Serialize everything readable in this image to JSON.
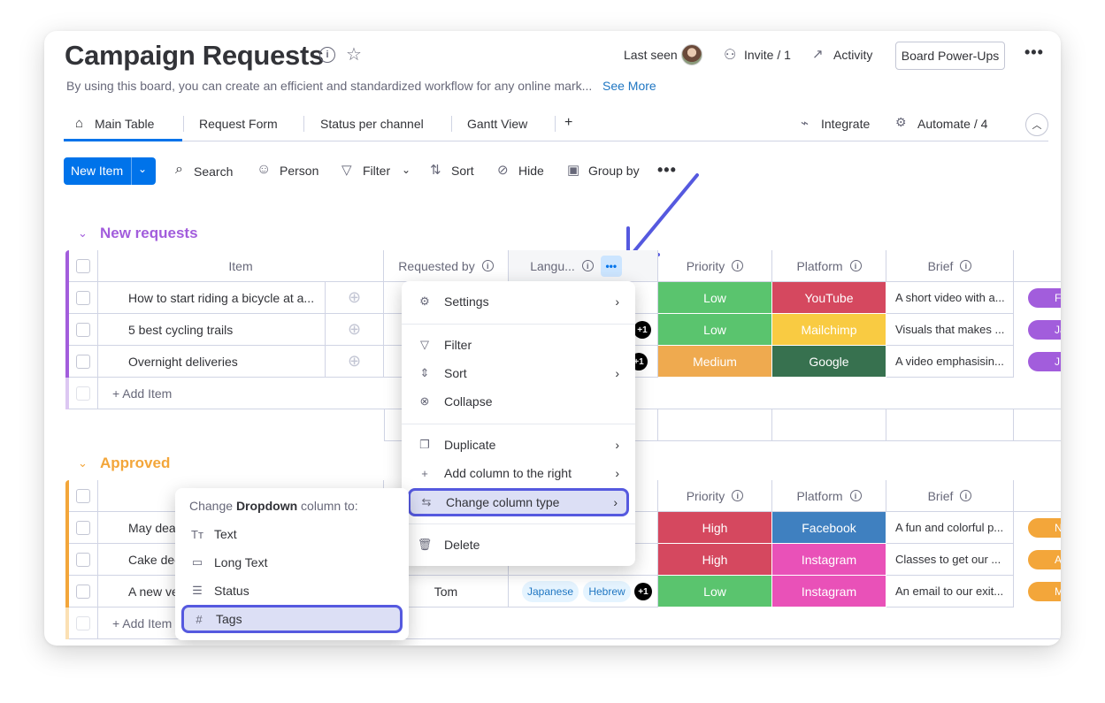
{
  "board": {
    "title": "Campaign Requests",
    "description": "By using this board, you can create an efficient and standardized workflow for any online mark...",
    "see_more": "See More",
    "last_seen": "Last seen",
    "invite": "Invite / 1",
    "activity": "Activity",
    "power_ups": "Board Power-Ups"
  },
  "tabs": [
    {
      "label": "Main Table"
    },
    {
      "label": "Request Form"
    },
    {
      "label": "Status per channel"
    },
    {
      "label": "Gantt View"
    }
  ],
  "tab_add": "+",
  "integrate": "Integrate",
  "automate": "Automate / 4",
  "toolbar": {
    "new_item": "New Item",
    "search": "Search",
    "person": "Person",
    "filter": "Filter",
    "sort": "Sort",
    "hide": "Hide",
    "group_by": "Group by"
  },
  "columns": {
    "item": "Item",
    "requested_by": "Requested by",
    "language": "Langu...",
    "priority": "Priority",
    "platform": "Platform",
    "brief": "Brief"
  },
  "groups": [
    {
      "title": "New requests",
      "color": "#a25ddc",
      "rows": [
        {
          "name": "How to start riding a bicycle at a...",
          "priority": "Low",
          "priority_color": "#5ac46e",
          "platform": "YouTube",
          "platform_color": "#d5485f",
          "brief": "A short video with a...",
          "side": "F"
        },
        {
          "name": "5 best cycling trails",
          "priority": "Low",
          "priority_color": "#5ac46e",
          "platform": "Mailchimp",
          "platform_color": "#f9cb42",
          "brief": "Visuals that makes ...",
          "side": "Ja",
          "plus": "+1"
        },
        {
          "name": "Overnight deliveries",
          "priority": "Medium",
          "priority_color": "#efaa4f",
          "platform": "Google",
          "platform_color": "#37714f",
          "brief": "A video emphasisin...",
          "side": "J",
          "plus": "+1"
        }
      ],
      "add_item": "+ Add Item"
    },
    {
      "title": "Approved",
      "color": "#f3a63a",
      "rows": [
        {
          "name": "May dea",
          "priority": "High",
          "priority_color": "#d5485f",
          "platform": "Facebook",
          "platform_color": "#3f80c0",
          "brief": "A fun and colorful p...",
          "side": "No"
        },
        {
          "name": "Cake dec",
          "priority": "High",
          "priority_color": "#d5485f",
          "platform": "Instagram",
          "platform_color": "#e951b8",
          "brief": "Classes to get our ...",
          "side": "Ap"
        },
        {
          "name": "A new ve",
          "requested_by": "Tom",
          "tags": [
            "Japanese",
            "Hebrew"
          ],
          "plus": "+1",
          "priority": "Low",
          "priority_color": "#5ac46e",
          "platform": "Instagram",
          "platform_color": "#e951b8",
          "brief": "An email to our exit...",
          "side": "M"
        }
      ],
      "add_item": "+ Add Item"
    }
  ],
  "column_menu": {
    "settings": "Settings",
    "filter": "Filter",
    "sort": "Sort",
    "collapse": "Collapse",
    "duplicate": "Duplicate",
    "add_column_right": "Add column to the right",
    "change_type": "Change column type",
    "delete": "Delete"
  },
  "type_menu": {
    "heading_prefix": "Change ",
    "heading_bold": "Dropdown",
    "heading_suffix": " column to:",
    "options": [
      "Text",
      "Long Text",
      "Status",
      "Tags"
    ]
  }
}
